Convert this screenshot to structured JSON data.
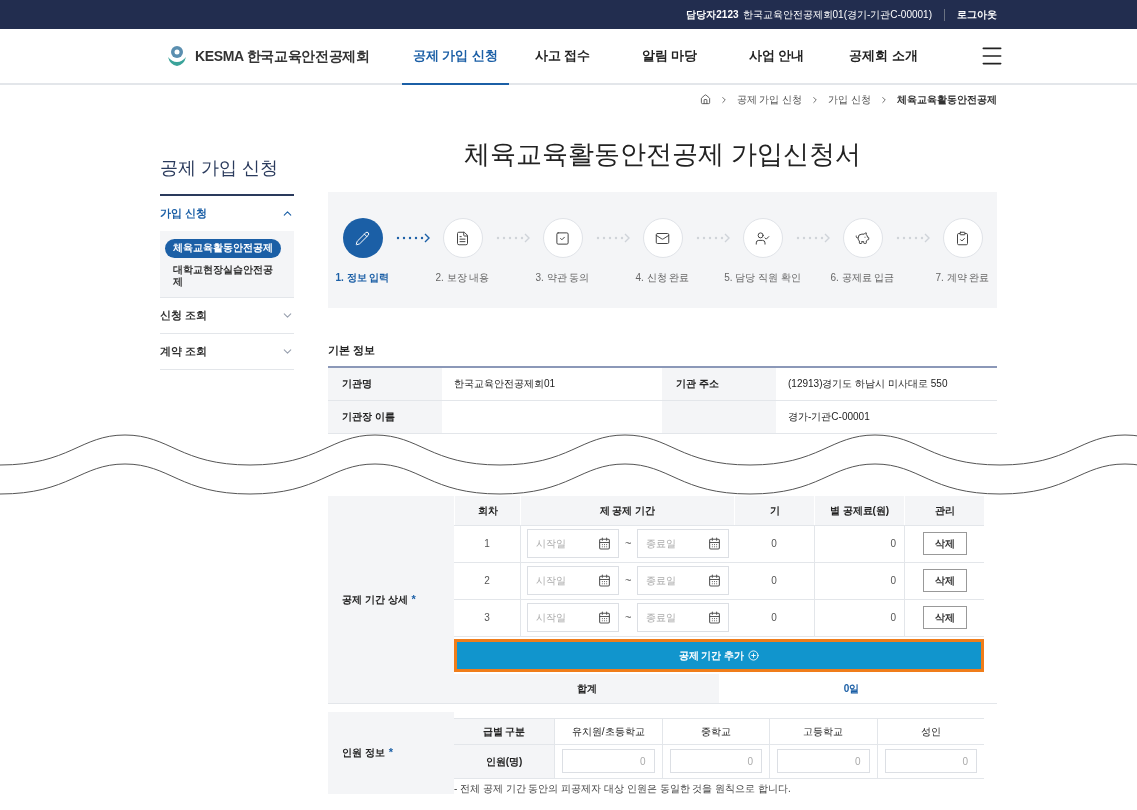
{
  "top_bar": {
    "user": "담당자2123",
    "org": "한국교육안전공제회01(경기-기관C-00001)",
    "logout": "로그아웃"
  },
  "header": {
    "logo": "KESMA 한국교육안전공제회",
    "nav": [
      {
        "label": "공제 가입 신청",
        "selected": true
      },
      {
        "label": "사고 접수",
        "selected": false
      },
      {
        "label": "알림 마당",
        "selected": false
      },
      {
        "label": "사업 안내",
        "selected": false
      },
      {
        "label": "공제회 소개",
        "selected": false
      }
    ]
  },
  "breadcrumb": [
    "공제 가입 신청",
    "가입 신청",
    "체육교육활동안전공제"
  ],
  "sidebar": {
    "title": "공제 가입 신청",
    "groups": [
      {
        "label": "가입 신청",
        "expanded": true,
        "children": [
          {
            "label": "체육교육활동안전공제",
            "selected": true
          },
          {
            "label": "대학교현장실습안전공제",
            "selected": false
          }
        ]
      },
      {
        "label": "신청 조회",
        "expanded": false
      },
      {
        "label": "계약 조회",
        "expanded": false
      }
    ]
  },
  "page_title": "체육교육활동안전공제 가입신청서",
  "steps": [
    {
      "label": "1. 정보 입력",
      "kind": "pencil",
      "selected": true
    },
    {
      "label": "2. 보장 내용",
      "kind": "document",
      "selected": false
    },
    {
      "label": "3. 약관 동의",
      "kind": "checkbox",
      "selected": false
    },
    {
      "label": "4. 신청 완료",
      "kind": "mail",
      "selected": false
    },
    {
      "label": "5. 담당 직원 확인",
      "kind": "user",
      "selected": false
    },
    {
      "label": "6. 공제료 입금",
      "kind": "payment",
      "selected": false
    },
    {
      "label": "7. 계약 완료",
      "kind": "clipboard",
      "selected": false
    }
  ],
  "basic_info": {
    "title": "기본 정보",
    "rows": [
      [
        {
          "label": "기관명",
          "value": "한국교육안전공제회01"
        },
        {
          "label": "기관 주소",
          "value": "(12913)경기도 하남시 미사대로 550"
        }
      ],
      [
        {
          "label": "기관장 이름"
        },
        {
          "value": "경가-기관C-00001"
        }
      ]
    ]
  },
  "period_detail": {
    "label": "공제 기간 상세",
    "required_mark": "*",
    "columns": [
      "회차",
      "제 공제 기간",
      "기",
      "별 공제료(원)",
      "관리"
    ],
    "rows": [
      {
        "round": "1",
        "start_placeholder": "시작일",
        "separator": "~",
        "end_placeholder": "종료일",
        "days": "0",
        "premium": "0",
        "action": "삭제"
      },
      {
        "round": "2",
        "start_placeholder": "시작일",
        "separator": "~",
        "end_placeholder": "종료일",
        "days": "0",
        "premium": "0",
        "action": "삭제"
      },
      {
        "round": "3",
        "start_placeholder": "시작일",
        "separator": "~",
        "end_placeholder": "종료일",
        "days": "0",
        "premium": "0",
        "action": "삭제"
      }
    ],
    "add_button": {
      "label": "공제 기간 추가",
      "focused": true
    },
    "total_label": "합계",
    "total_value": "0일"
  },
  "people": {
    "label": "인원 정보",
    "required_mark": "*",
    "header_label": "급별 구분",
    "columns": [
      "유치원/초등학교",
      "중학교",
      "고등학교",
      "성인"
    ],
    "row_label": "인원(명)",
    "placeholders": [
      "0",
      "0",
      "0",
      "0"
    ]
  },
  "note": "- 전체 공제 기간 동안의 피공제자 대상 인원은 동일한 것을 원칙으로 합니다."
}
